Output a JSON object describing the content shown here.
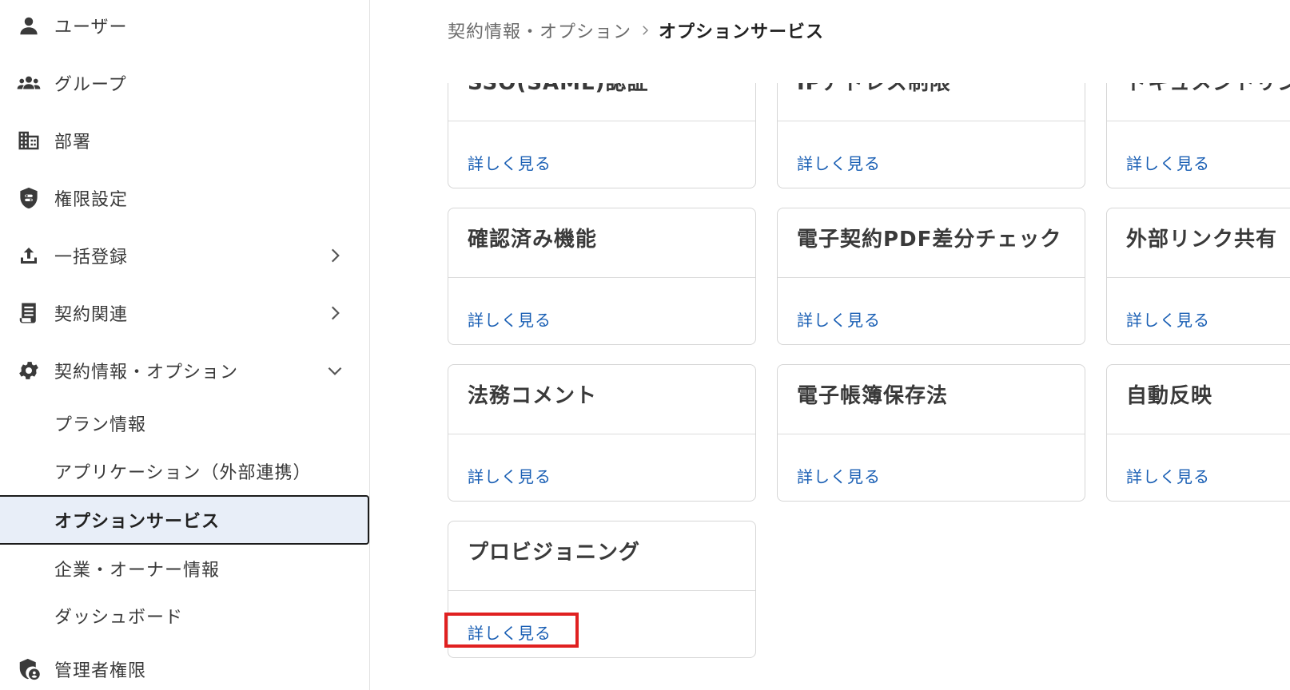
{
  "sidebar": {
    "items": [
      {
        "label": "ユーザー",
        "icon": "person-icon"
      },
      {
        "label": "グループ",
        "icon": "group-icon"
      },
      {
        "label": "部署",
        "icon": "building-icon"
      },
      {
        "label": "権限設定",
        "icon": "shield-icon"
      },
      {
        "label": "一括登録",
        "icon": "upload-icon",
        "chevron": "chevron-right-icon"
      },
      {
        "label": "契約関連",
        "icon": "document-icon",
        "chevron": "chevron-right-icon"
      },
      {
        "label": "契約情報・オプション",
        "icon": "gear-icon",
        "chevron": "chevron-down-icon"
      }
    ],
    "sub_items": [
      {
        "label": "プラン情報"
      },
      {
        "label": "アプリケーション（外部連携）"
      },
      {
        "label": "オプションサービス",
        "active": true
      },
      {
        "label": "企業・オーナー情報"
      },
      {
        "label": "ダッシュボード"
      }
    ],
    "admin": {
      "label": "管理者権限",
      "icon": "admin-shield-icon"
    }
  },
  "breadcrumb": {
    "parent": "契約情報・オプション",
    "separator_icon": "chevron-right-icon",
    "current": "オプションサービス"
  },
  "cards": [
    {
      "title": "SSO(SAML)認証",
      "link": "詳しく見る"
    },
    {
      "title": "IPアドレス制限",
      "link": "詳しく見る"
    },
    {
      "title": "ドキュメントリンク",
      "link": "詳しく見る"
    },
    {
      "title": "確認済み機能",
      "link": "詳しく見る"
    },
    {
      "title": "電子契約PDF差分チェック",
      "link": "詳しく見る"
    },
    {
      "title": "外部リンク共有",
      "link": "詳しく見る"
    },
    {
      "title": "法務コメント",
      "link": "詳しく見る"
    },
    {
      "title": "電子帳簿保存法",
      "link": "詳しく見る"
    },
    {
      "title": "自動反映",
      "link": "詳しく見る"
    },
    {
      "title": "プロビジョニング",
      "link": "詳しく見る"
    }
  ],
  "colors": {
    "accent": "#1a5fb4",
    "active_bg": "#e8eef8",
    "highlight": "#e02020"
  }
}
